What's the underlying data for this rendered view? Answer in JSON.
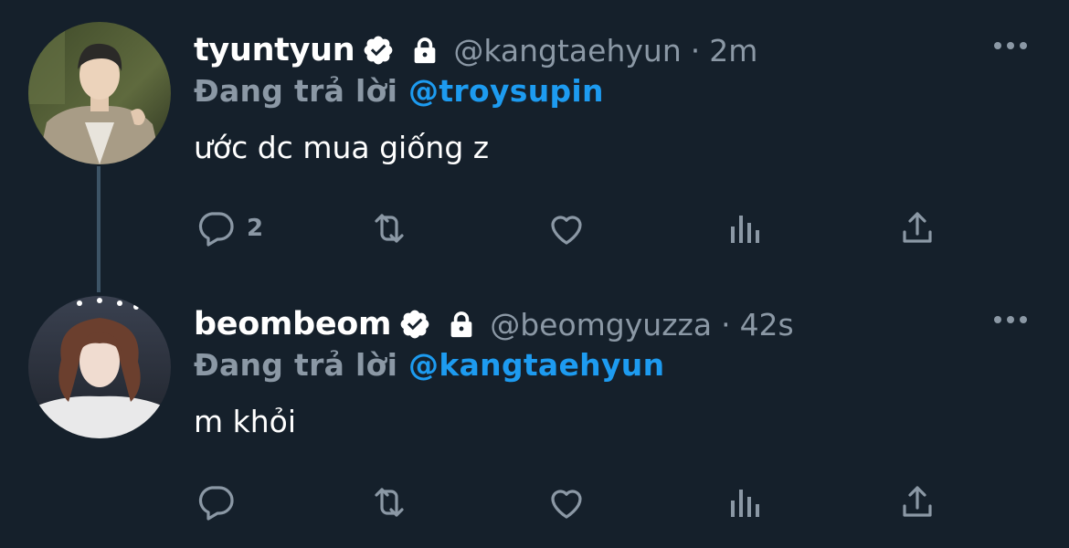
{
  "colors": {
    "background": "#15202b",
    "muted": "#8b98a5",
    "accent": "#1d9bf0",
    "text": "#ffffff"
  },
  "tweets": [
    {
      "display_name": "tyuntyun",
      "handle": "@kangtaehyun",
      "separator": "·",
      "time": "2m",
      "reply_prefix": "Đang trả lời",
      "reply_to": "@troysupin",
      "text": "ước dc mua giống z",
      "reply_count": "2",
      "icons": [
        "verified-icon",
        "lock-icon",
        "more-icon",
        "reply-icon",
        "retweet-icon",
        "like-icon",
        "views-icon",
        "share-icon"
      ]
    },
    {
      "display_name": "beombeom",
      "handle": "@beomgyuzza",
      "separator": "·",
      "time": "42s",
      "reply_prefix": "Đang trả lời",
      "reply_to": "@kangtaehyun",
      "text": "m khỏi",
      "reply_count": "",
      "icons": [
        "verified-icon",
        "lock-icon",
        "more-icon",
        "reply-icon",
        "retweet-icon",
        "like-icon",
        "views-icon",
        "share-icon"
      ]
    }
  ]
}
